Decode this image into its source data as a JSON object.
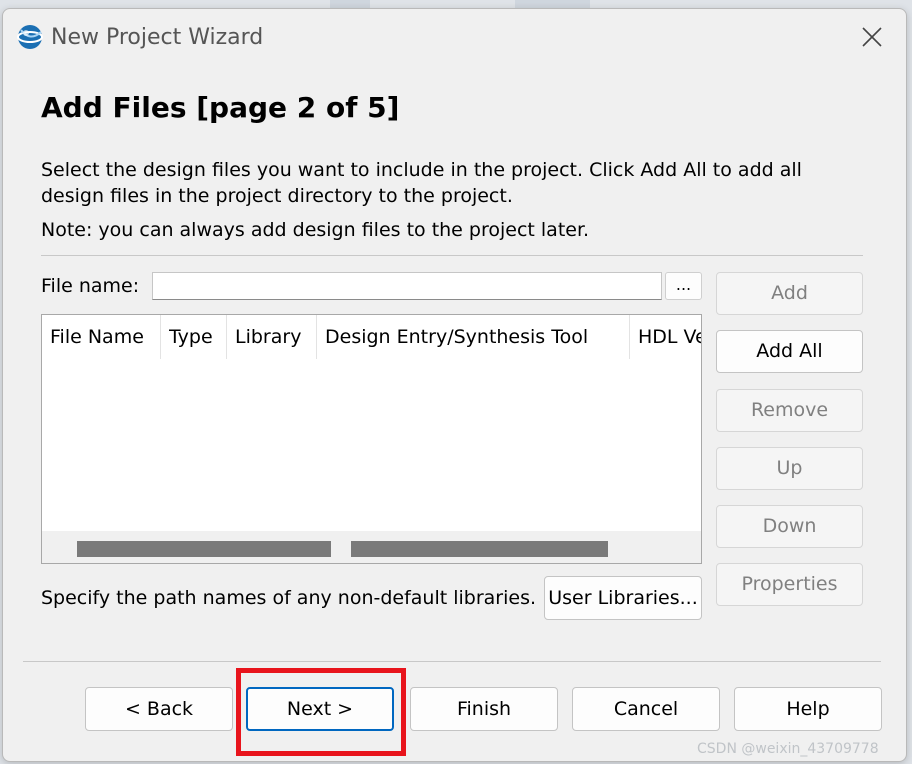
{
  "window": {
    "title": "New Project Wizard",
    "icon": "quartus-globe-icon",
    "close_icon": "close-icon"
  },
  "page": {
    "heading": "Add Files [page 2 of 5]",
    "description": "Select the design files you want to include in the project. Click Add All to add all design files in the project directory to the project.",
    "note": "Note: you can always add design files to the project later."
  },
  "file_name": {
    "label": "File name:",
    "value": "",
    "browse_label": "..."
  },
  "table": {
    "columns": [
      "File Name",
      "Type",
      "Library",
      "Design Entry/Synthesis Tool",
      "HDL Version"
    ],
    "rows": []
  },
  "side_buttons": [
    {
      "label": "Add",
      "enabled": false
    },
    {
      "label": "Add All",
      "enabled": true
    },
    {
      "label": "Remove",
      "enabled": false
    },
    {
      "label": "Up",
      "enabled": false
    },
    {
      "label": "Down",
      "enabled": false
    },
    {
      "label": "Properties",
      "enabled": false
    }
  ],
  "libraries": {
    "text": "Specify the path names of any non-default libraries.",
    "button_label": "User Libraries..."
  },
  "nav": {
    "back": "< Back",
    "next": "Next >",
    "finish": "Finish",
    "cancel": "Cancel",
    "help": "Help"
  },
  "watermark": "CSDN @weixin_43709778",
  "colors": {
    "highlight": "#e8141c",
    "default_button_border": "#0067c0"
  }
}
